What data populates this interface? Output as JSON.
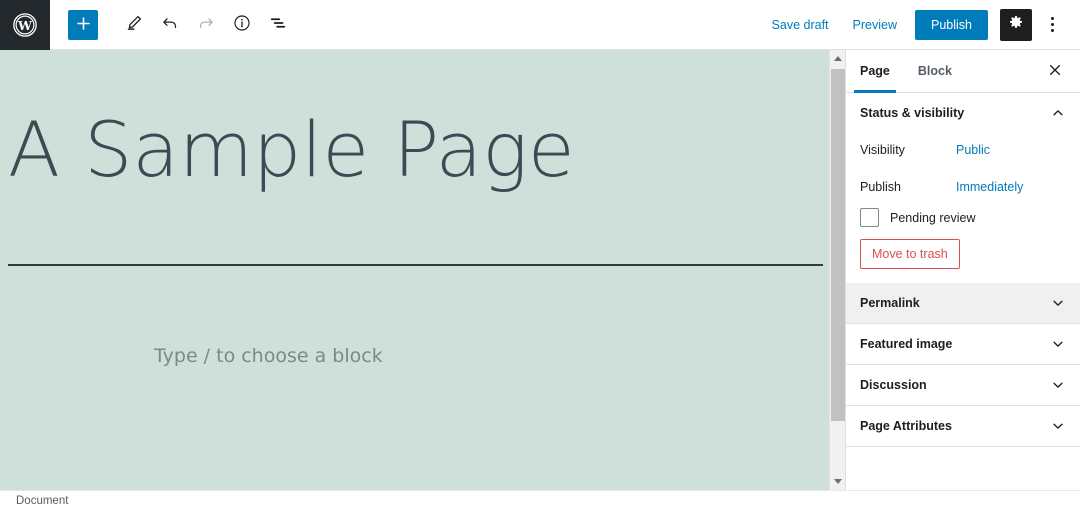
{
  "toolbar": {
    "logo_name": "wordpress-logo",
    "add_block_label": "+",
    "buttons": [
      {
        "name": "add-block-button",
        "icon": "plus-icon",
        "label": "Add block"
      },
      {
        "name": "edit-tool-button",
        "icon": "pencil-icon",
        "label": "Tools"
      },
      {
        "name": "undo-button",
        "icon": "undo-arrow-icon",
        "label": "Undo"
      },
      {
        "name": "redo-button",
        "icon": "redo-arrow-icon",
        "label": "Redo",
        "disabled": true
      },
      {
        "name": "details-button",
        "icon": "info-circle-icon",
        "label": "Details"
      },
      {
        "name": "list-view-button",
        "icon": "list-view-icon",
        "label": "List view"
      }
    ],
    "save_draft_label": "Save draft",
    "preview_label": "Preview",
    "publish_label": "Publish",
    "settings_label": "Settings",
    "options_label": "Options"
  },
  "editor": {
    "post_title": "A Sample Page",
    "block_placeholder": "Type / to choose a block",
    "canvas_color": "#cfe0da"
  },
  "sidebar": {
    "tabs": [
      {
        "label": "Page",
        "active": true
      },
      {
        "label": "Block",
        "active": false
      }
    ],
    "close_label": "Close settings",
    "status_panel": {
      "title": "Status & visibility",
      "expanded": true,
      "visibility_label": "Visibility",
      "visibility_value": "Public",
      "publish_label": "Publish",
      "publish_value": "Immediately",
      "pending_review_label": "Pending review",
      "pending_review_checked": false,
      "move_to_trash_label": "Move to trash"
    },
    "panels": [
      {
        "title": "Permalink",
        "hovered": true
      },
      {
        "title": "Featured image",
        "hovered": false
      },
      {
        "title": "Discussion",
        "hovered": false
      },
      {
        "title": "Page Attributes",
        "hovered": false
      }
    ]
  },
  "status_bar": {
    "document_label": "Document"
  },
  "colors": {
    "wp_blue": "#007cba",
    "dark_bar": "#23282d",
    "trash_red": "#d94f4f",
    "canvas_green": "#cfe0da"
  }
}
